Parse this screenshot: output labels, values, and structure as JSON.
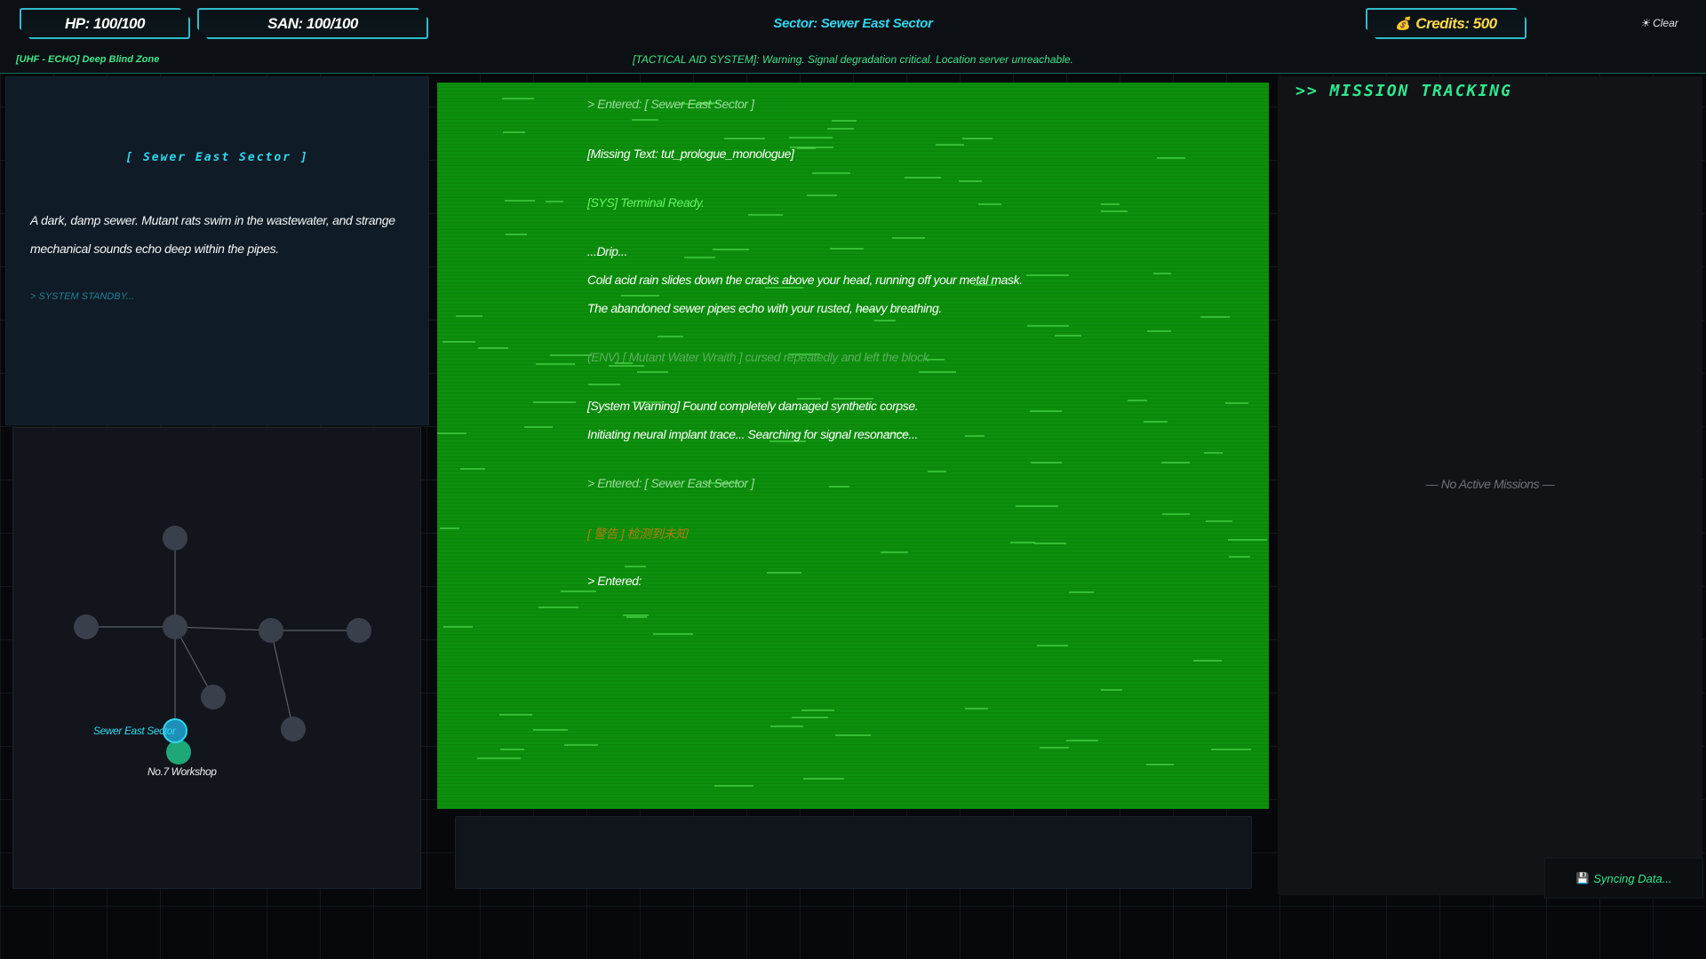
{
  "hud": {
    "hp": "HP: 100/100",
    "san": "SAN: 100/100",
    "sector": "Sector: Sewer East Sector",
    "credits_icon": "💰",
    "credits": "Credits: 500",
    "clear": "☀ Clear",
    "zone": "[UHF - ECHO] Deep Blind Zone",
    "tactical": "[TACTICAL AID SYSTEM]: Warning. Signal degradation critical. Location server unreachable."
  },
  "location": {
    "name": "[ Sewer East Sector ]",
    "description": "A dark, damp sewer. Mutant rats swim in the wastewater, and strange mechanical sounds echo deep within the pipes.",
    "standby": "> SYSTEM STANDBY..."
  },
  "map": {
    "current_node_label": "Sewer East Sector",
    "workshop_node_label": "No.7 Workshop",
    "colors": {
      "node": "#3a3f4c",
      "current": "#2fbce8",
      "workshop": "#1ea878",
      "edge": "#5a5f68"
    }
  },
  "terminal": {
    "lines": [
      {
        "text": "> Entered: [ Sewer East Sector ]",
        "style": "dim"
      },
      {
        "text": "[Missing Text: tut_prologue_monologue]",
        "style": "white"
      },
      {
        "text": "[SYS] Terminal Ready.",
        "style": "sys"
      },
      {
        "text": "...Drip...",
        "style": "white"
      },
      {
        "text": "Cold acid rain slides down the cracks above your head, running off your metal mask.",
        "style": "white"
      },
      {
        "text": "The abandoned sewer pipes echo with your rusted, heavy breathing.",
        "style": "white"
      },
      {
        "text": "(ENV) [ Mutant Water Wraith ] cursed repeatedly and left the block",
        "style": "env"
      },
      {
        "text": "[System Warning] Found completely damaged synthetic corpse.",
        "style": "white"
      },
      {
        "text": "Initiating neural implant trace... Searching for signal resonance...",
        "style": "white"
      },
      {
        "text": "> Entered: [ Sewer East Sector ]",
        "style": "dim"
      },
      {
        "text": "[ 警告 ] 检测到未知",
        "style": "warn"
      },
      {
        "text": "> Entered:",
        "style": "white"
      }
    ]
  },
  "missions": {
    "title": ">> MISSION TRACKING",
    "empty": "— No Active Missions —"
  },
  "sync": {
    "icon": "💾",
    "label": "Syncing Data..."
  }
}
